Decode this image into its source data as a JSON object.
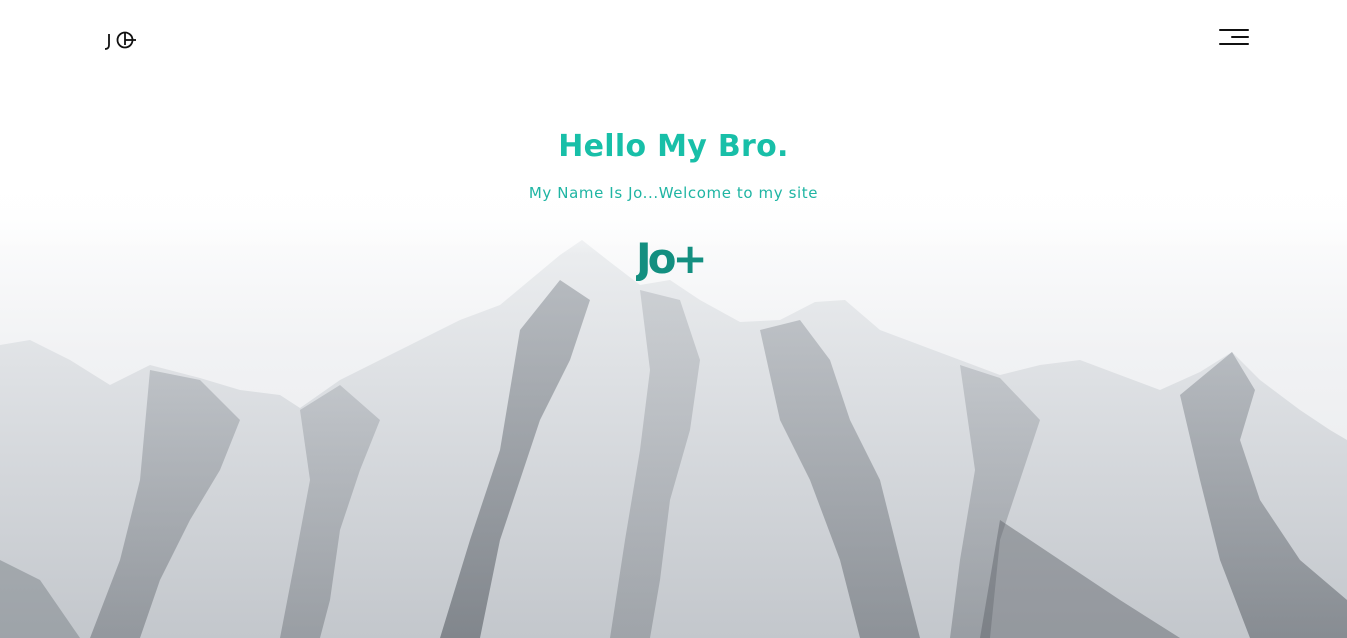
{
  "header": {
    "logo_text": "JO",
    "menu_icon": "hamburger-menu-icon"
  },
  "hero": {
    "title": "Hello My Bro.",
    "subtitle": "My Name Is Jo...Welcome to my site",
    "mark_text": "Jo+",
    "background": "snow-capped mountain range"
  },
  "colors": {
    "accent": "#18bfa8",
    "mark": "#138f80",
    "text_dark": "#111111",
    "background": "#ffffff"
  }
}
